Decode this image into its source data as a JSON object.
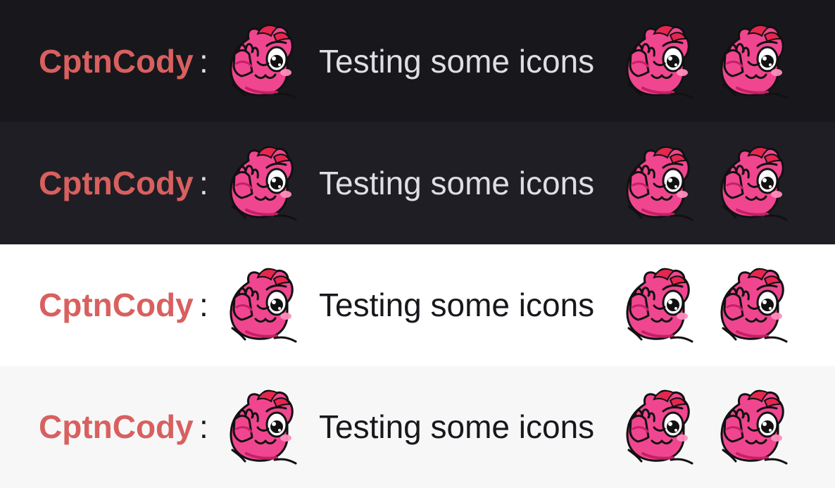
{
  "theme": {
    "username_color": "#d8605f",
    "emote_pink": "#f0468f",
    "emote_dark_pink": "#c51f67",
    "emote_light_pink": "#ff8ebd",
    "emote_red": "#e6264e"
  },
  "rows": [
    {
      "background": "#18171c",
      "text_color": "#dedee3",
      "colon_color": "#dedee3",
      "username": "CptnCody",
      "separator": ":",
      "message": "Testing some icons",
      "emote_icon": "pink-dino-wave-emote-icon"
    },
    {
      "background": "#1f1e24",
      "text_color": "#dedee3",
      "colon_color": "#dedee3",
      "username": "CptnCody",
      "separator": ":",
      "message": "Testing some icons",
      "emote_icon": "pink-dino-wave-emote-icon"
    },
    {
      "background": "#ffffff",
      "text_color": "#18171c",
      "colon_color": "#18171c",
      "username": "CptnCody",
      "separator": ":",
      "message": "Testing some icons",
      "emote_icon": "pink-dino-wave-emote-icon"
    },
    {
      "background": "#f7f7f8",
      "text_color": "#18171c",
      "colon_color": "#18171c",
      "username": "CptnCody",
      "separator": ":",
      "message": "Testing some icons",
      "emote_icon": "pink-dino-wave-emote-icon"
    }
  ]
}
